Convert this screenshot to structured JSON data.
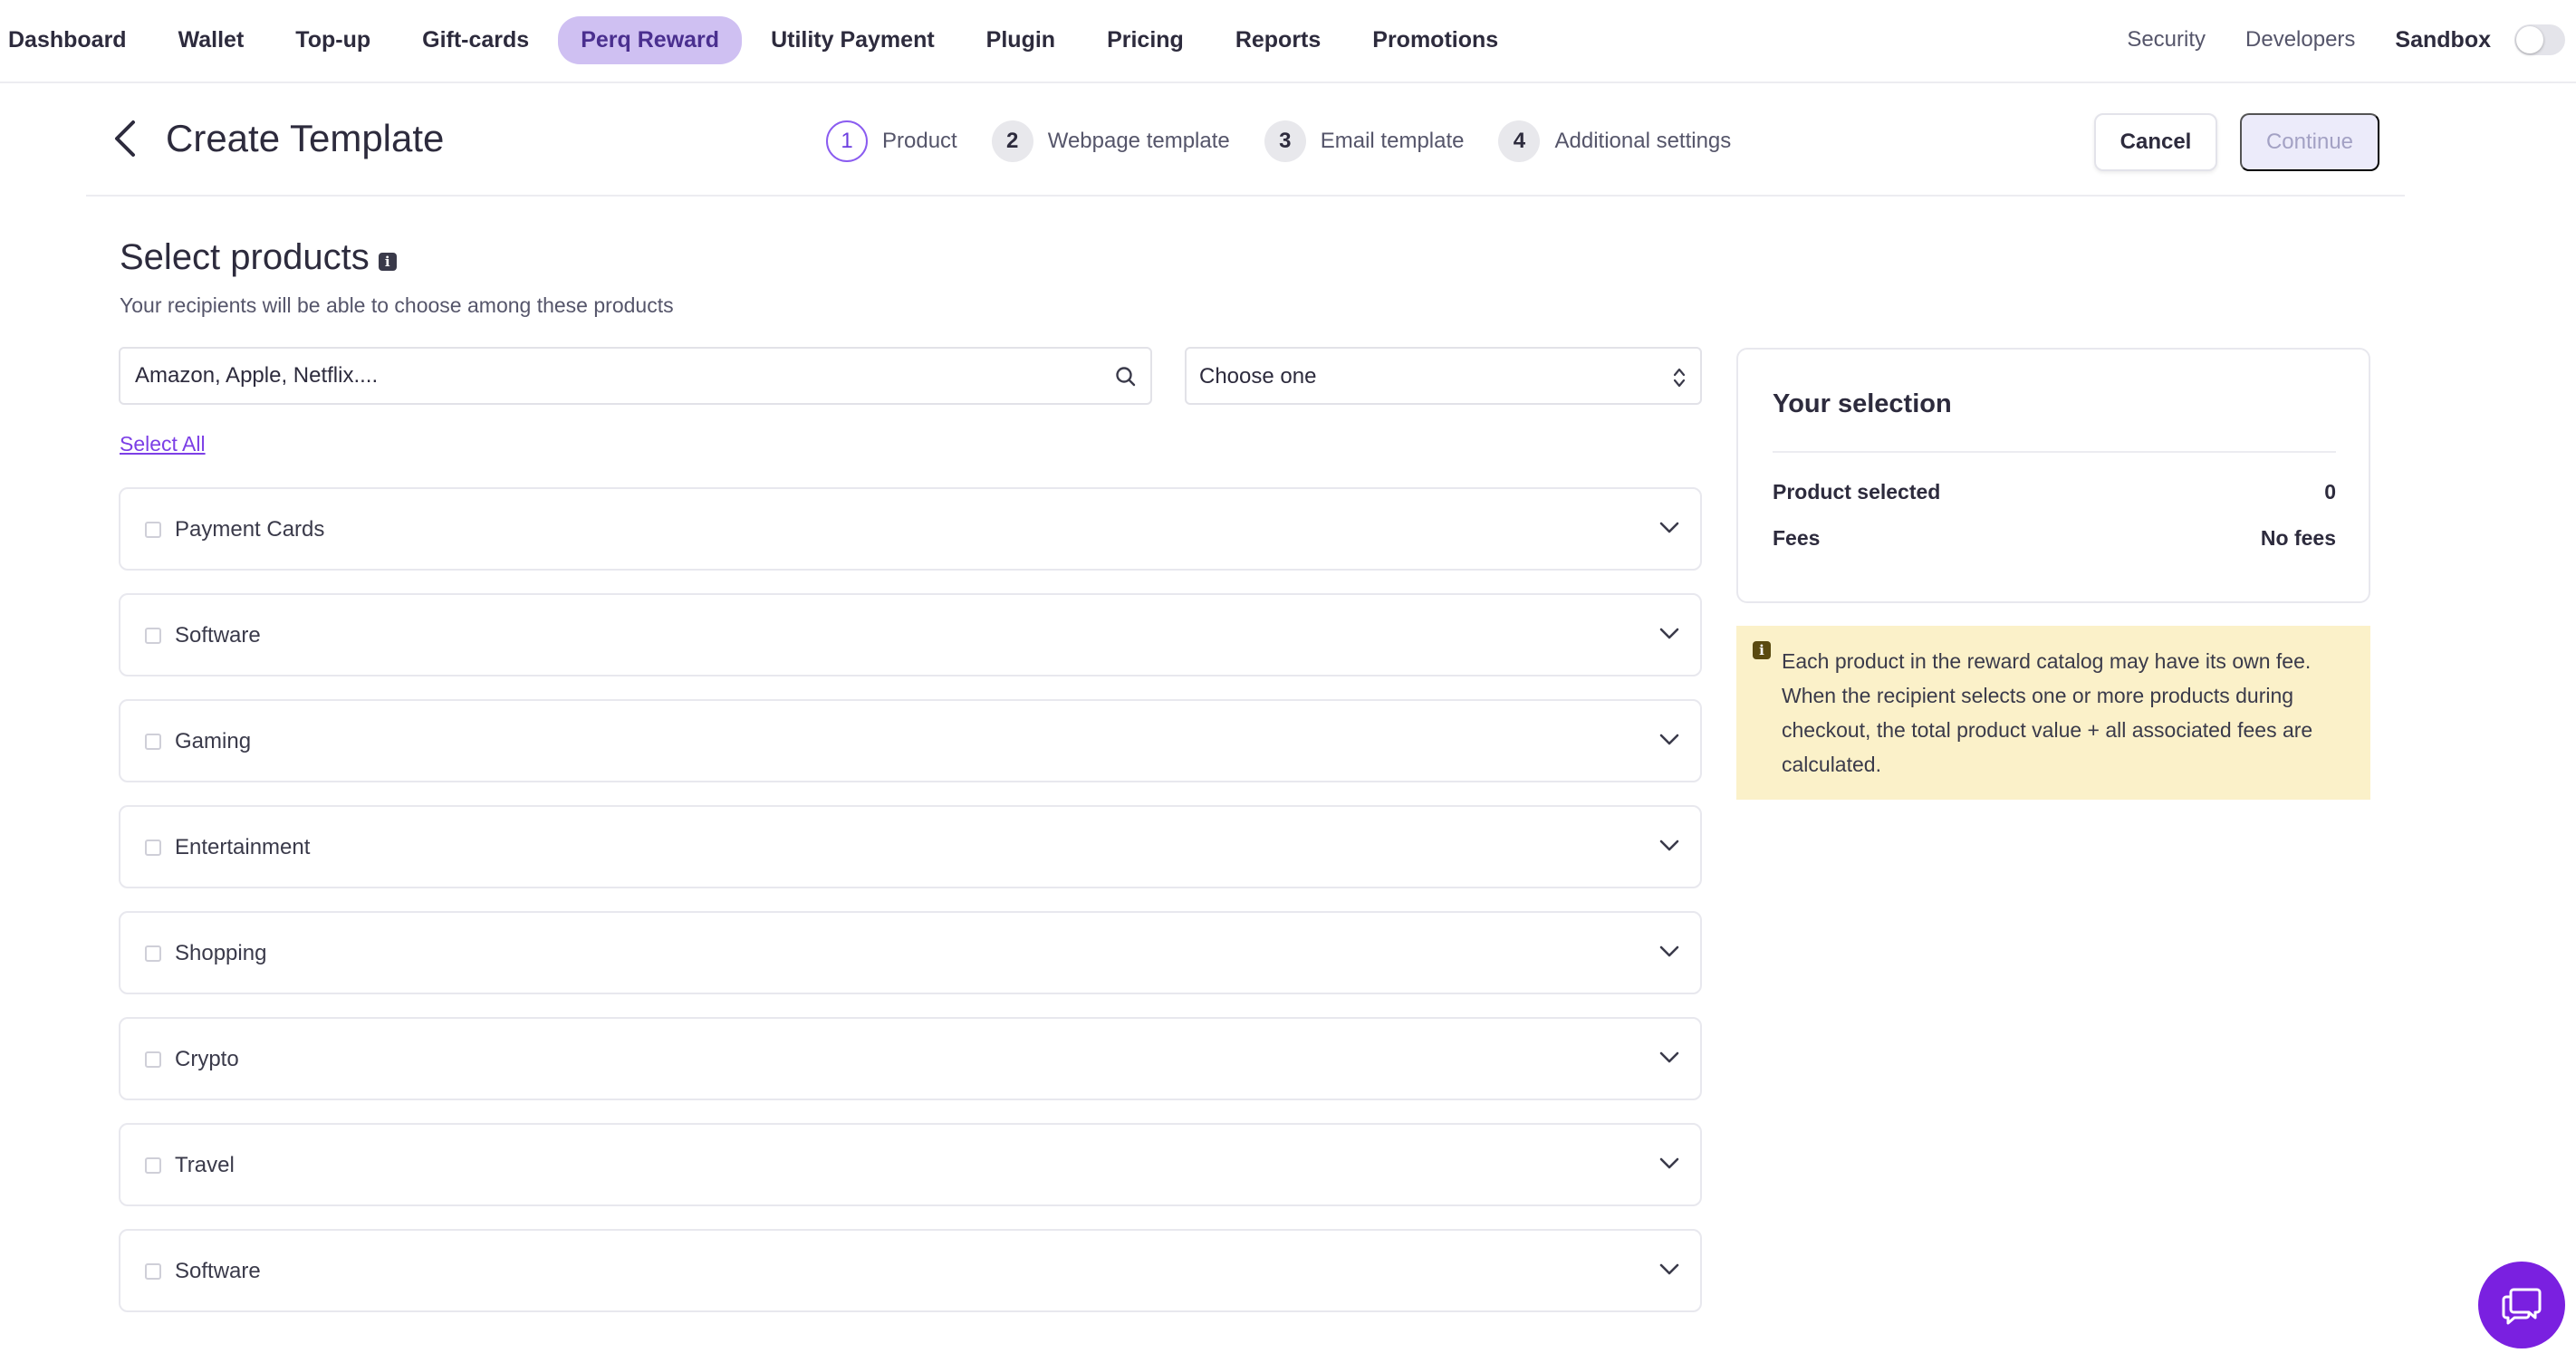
{
  "nav": {
    "items": [
      {
        "label": "Dashboard"
      },
      {
        "label": "Wallet"
      },
      {
        "label": "Top-up"
      },
      {
        "label": "Gift-cards"
      },
      {
        "label": "Perq Reward",
        "active": true
      },
      {
        "label": "Utility Payment"
      },
      {
        "label": "Plugin"
      },
      {
        "label": "Pricing"
      },
      {
        "label": "Reports"
      },
      {
        "label": "Promotions"
      }
    ],
    "security": "Security",
    "developers": "Developers",
    "sandbox": "Sandbox",
    "sandbox_on": false
  },
  "header": {
    "title": "Create Template",
    "steps": [
      {
        "num": "1",
        "label": "Product",
        "active": true
      },
      {
        "num": "2",
        "label": "Webpage template"
      },
      {
        "num": "3",
        "label": "Email template"
      },
      {
        "num": "4",
        "label": "Additional settings"
      }
    ],
    "cancel": "Cancel",
    "continue": "Continue"
  },
  "products": {
    "title": "Select products",
    "subtitle": "Your recipients will be able to choose among these products",
    "search_placeholder": "Amazon, Apple, Netflix....",
    "select_value": "Choose one",
    "select_all": "Select All",
    "categories": [
      {
        "label": "Payment Cards"
      },
      {
        "label": "Software"
      },
      {
        "label": "Gaming"
      },
      {
        "label": "Entertainment"
      },
      {
        "label": "Shopping"
      },
      {
        "label": "Crypto"
      },
      {
        "label": "Travel"
      },
      {
        "label": "Software"
      }
    ]
  },
  "selection": {
    "title": "Your selection",
    "product_selected_label": "Product selected",
    "product_selected_value": "0",
    "fees_label": "Fees",
    "fees_value": "No fees"
  },
  "note": {
    "text": "Each product in the reward catalog may have its own fee. When the recipient selects one or more products during checkout, the total product value + all associated fees are calculated."
  },
  "colors": {
    "accent": "#7c3fe6",
    "nav_active_bg": "#cfc0f2",
    "note_bg": "#fbf1c9",
    "chat_bg": "#7a20e0"
  }
}
